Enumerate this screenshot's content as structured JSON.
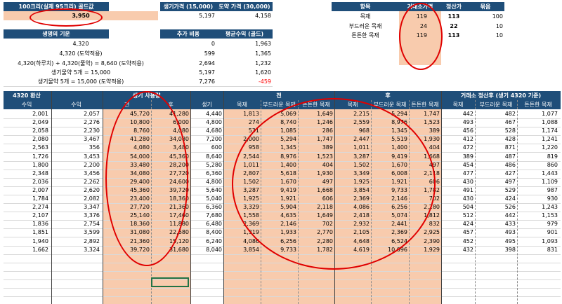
{
  "top": {
    "h1": "100크리(실제 95크리) 골드값",
    "h2": "생기가격 (15,000)",
    "h3": "도약 가격 (30,000)",
    "v1": "3,950",
    "v2": "5,197",
    "v3": "4,158"
  },
  "cost": {
    "headers": [
      "생명의 기운",
      "추가 비용",
      "평균수익 (골드)"
    ],
    "rows": [
      [
        "4,320",
        "0",
        "1,963"
      ],
      [
        "4,320 (도약적용)",
        "599",
        "1,365"
      ],
      [
        "4,320(하루치) + 4,320(풀악) = 8,640 (도약적용)",
        "2,694",
        "1,232"
      ],
      [
        "생기물약 5개 = 15,000",
        "5,197",
        "1,620"
      ],
      [
        "생기물약 5개 = 15,000 (도약적용)",
        "7,276",
        "-459"
      ]
    ]
  },
  "items": {
    "headers": [
      "항목",
      "거래소가격",
      "정산가",
      "묶음"
    ],
    "rows": [
      [
        "목재",
        "119",
        "113",
        "100"
      ],
      [
        "부드러운 목재",
        "24",
        "22",
        "10"
      ],
      [
        "튼튼한 목재",
        "119",
        "113",
        "10"
      ]
    ]
  },
  "main": {
    "group_headers": [
      "4320 환산",
      "생기 사용량",
      "전",
      "후",
      "거래소 정산후 (생기 4320 기준)"
    ],
    "sub_headers": [
      "수익",
      "수익",
      "전",
      "후",
      "생기",
      "목재",
      "부드러운 목재",
      "튼튼한 목재",
      "목재",
      "부드러운 목재",
      "튼튼한 목재",
      "목재",
      "부드러운 목재",
      "튼튼한 목재"
    ],
    "rows": [
      [
        "2,001",
        "2,057",
        "45,720",
        "41,280",
        "4,440",
        "1,813",
        "5,069",
        "1,649",
        "2,215",
        "5,294",
        "1,747",
        "442",
        "482",
        "1,077"
      ],
      [
        "2,049",
        "2,276",
        "10,800",
        "6,000",
        "4,800",
        "274",
        "8,740",
        "1,246",
        "2,559",
        "8,976",
        "1,523",
        "493",
        "467",
        "1,088"
      ],
      [
        "2,058",
        "2,230",
        "8,760",
        "4,080",
        "4,680",
        "531",
        "1,085",
        "286",
        "968",
        "1,345",
        "389",
        "456",
        "528",
        "1,174"
      ],
      [
        "2,080",
        "3,467",
        "41,280",
        "34,080",
        "7,200",
        "2,000",
        "5,294",
        "1,747",
        "2,447",
        "5,519",
        "1,930",
        "412",
        "428",
        "1,241"
      ],
      [
        "2,563",
        "356",
        "4,080",
        "3,480",
        "600",
        "958",
        "1,345",
        "389",
        "1,011",
        "1,400",
        "404",
        "472",
        "871",
        "1,220"
      ],
      [
        "1,726",
        "3,453",
        "54,000",
        "45,360",
        "8,640",
        "2,544",
        "8,976",
        "1,523",
        "3,287",
        "9,419",
        "1,668",
        "389",
        "487",
        "819"
      ],
      [
        "1,800",
        "2,200",
        "33,480",
        "28,200",
        "5,280",
        "1,011",
        "1,400",
        "404",
        "1,502",
        "1,670",
        "497",
        "454",
        "486",
        "860"
      ],
      [
        "2,348",
        "3,456",
        "34,080",
        "27,720",
        "6,360",
        "2,807",
        "5,618",
        "1,930",
        "3,349",
        "6,008",
        "2,118",
        "477",
        "427",
        "1,443"
      ],
      [
        "2,036",
        "2,262",
        "29,400",
        "24,600",
        "4,800",
        "1,502",
        "1,670",
        "497",
        "1,925",
        "1,921",
        "606",
        "430",
        "497",
        "1,109"
      ],
      [
        "2,007",
        "2,620",
        "45,360",
        "39,720",
        "5,640",
        "3,287",
        "9,419",
        "1,668",
        "3,854",
        "9,733",
        "1,782",
        "491",
        "529",
        "987"
      ],
      [
        "1,784",
        "2,082",
        "23,400",
        "18,360",
        "5,040",
        "1,925",
        "1,921",
        "606",
        "2,369",
        "2,146",
        "702",
        "430",
        "424",
        "930"
      ],
      [
        "2,274",
        "3,347",
        "27,720",
        "21,360",
        "6,360",
        "3,329",
        "5,904",
        "2,118",
        "4,086",
        "6,256",
        "2,280",
        "504",
        "526",
        "1,243"
      ],
      [
        "2,107",
        "3,376",
        "25,140",
        "17,460",
        "7,680",
        "1,558",
        "4,635",
        "1,649",
        "2,418",
        "5,074",
        "1,812",
        "512",
        "442",
        "1,153"
      ],
      [
        "1,836",
        "2,754",
        "18,360",
        "11,880",
        "6,480",
        "2,369",
        "2,146",
        "702",
        "2,932",
        "2,441",
        "832",
        "424",
        "433",
        "979"
      ],
      [
        "1,851",
        "3,599",
        "31,080",
        "22,680",
        "8,400",
        "1,319",
        "1,933",
        "2,770",
        "2,105",
        "2,369",
        "2,925",
        "457",
        "493",
        "901"
      ],
      [
        "1,940",
        "2,892",
        "21,360",
        "15,120",
        "6,240",
        "4,086",
        "6,256",
        "2,280",
        "4,648",
        "6,524",
        "2,390",
        "452",
        "495",
        "1,093"
      ],
      [
        "1,662",
        "3,324",
        "39,720",
        "31,680",
        "8,040",
        "3,854",
        "9,733",
        "1,782",
        "4,619",
        "10,096",
        "1,929",
        "432",
        "398",
        "831"
      ]
    ]
  }
}
